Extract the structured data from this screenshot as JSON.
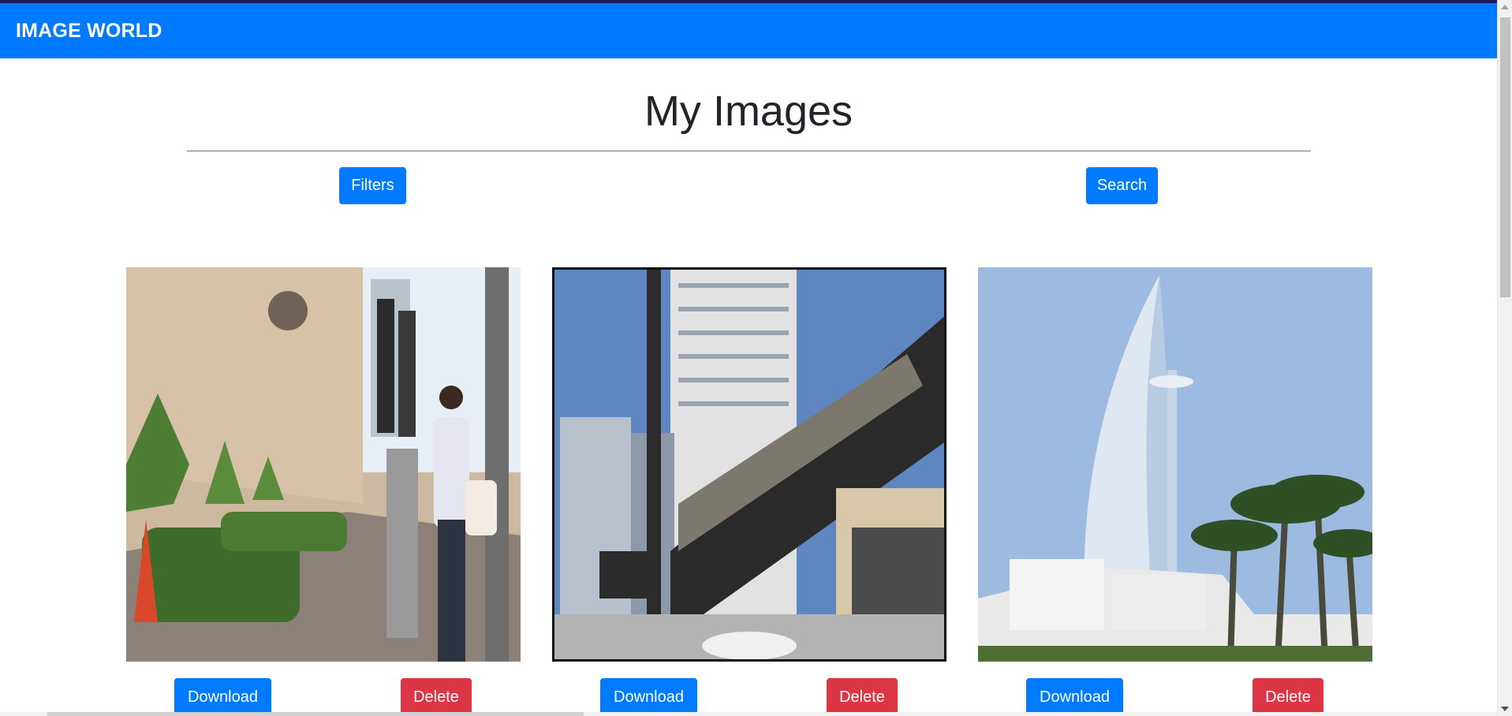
{
  "navbar": {
    "brand": "IMAGE WORLD"
  },
  "page": {
    "title": "My Images"
  },
  "toolbar": {
    "filters_label": "Filters",
    "search_label": "Search"
  },
  "cards": [
    {
      "download_label": "Download",
      "delete_label": "Delete"
    },
    {
      "download_label": "Download",
      "delete_label": "Delete"
    },
    {
      "download_label": "Download",
      "delete_label": "Delete"
    }
  ],
  "colors": {
    "primary": "#007bff",
    "danger": "#dc3545",
    "text": "#212529"
  }
}
